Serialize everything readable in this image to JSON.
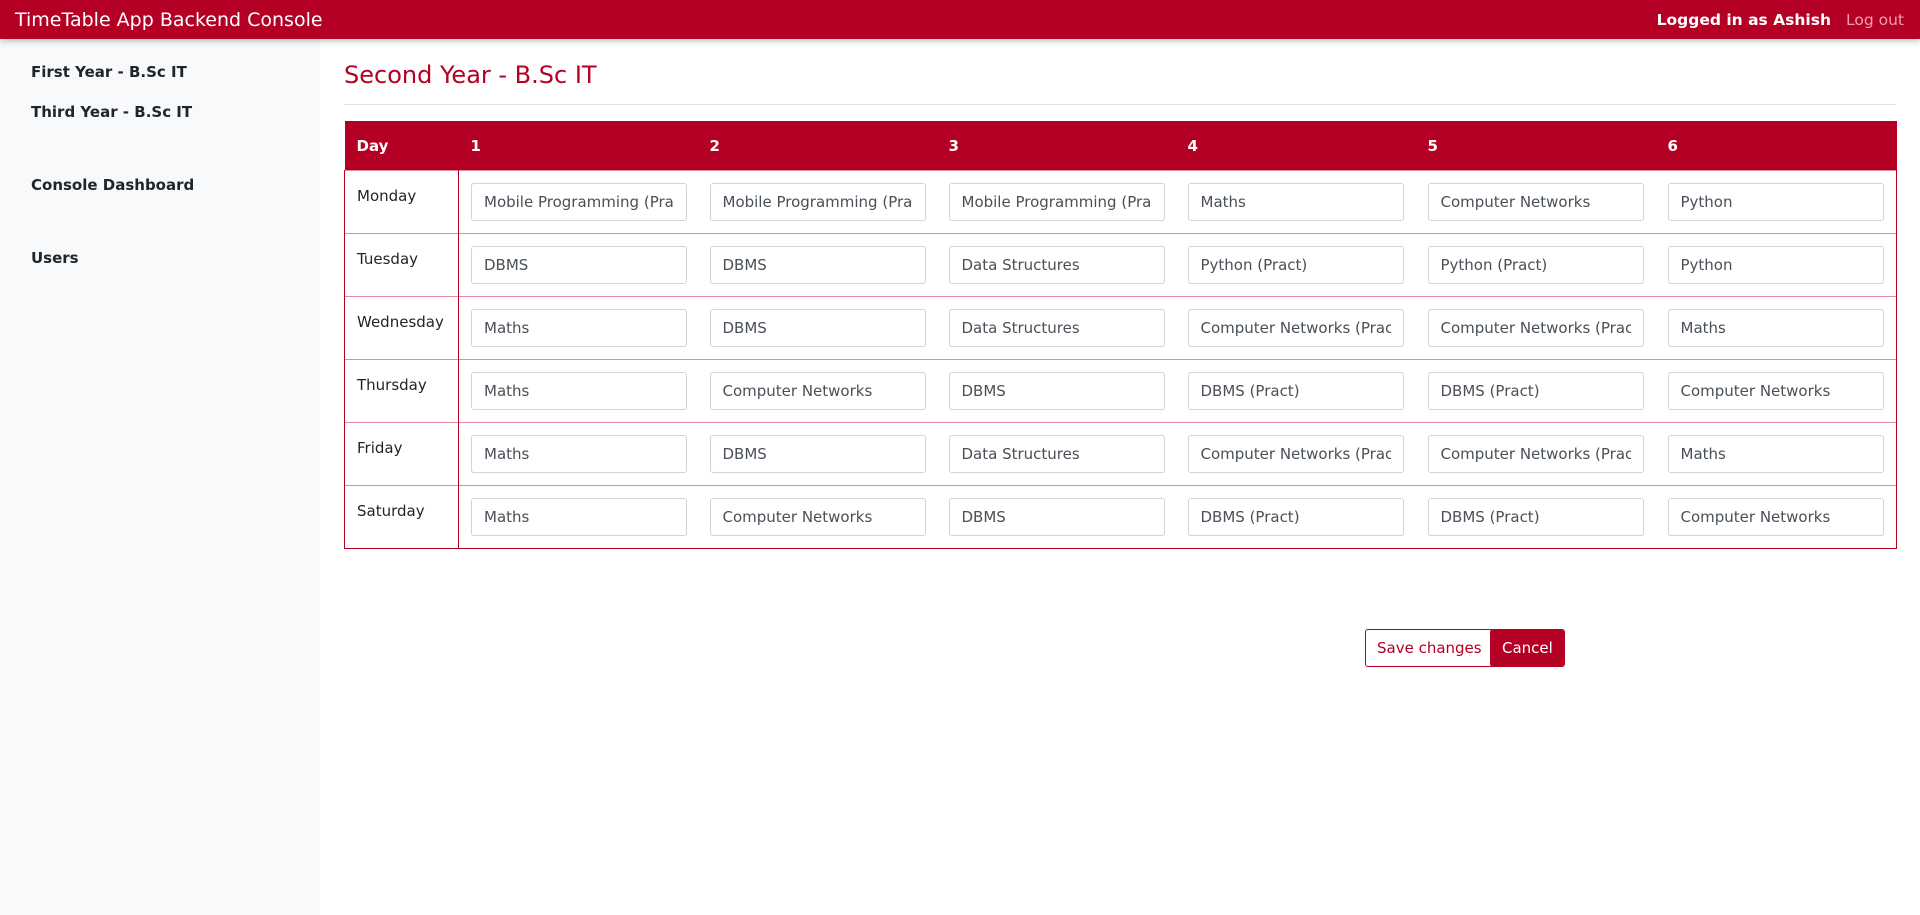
{
  "navbar": {
    "brand": "TimeTable App Backend Console",
    "logged_in": "Logged in as Ashish",
    "logout": "Log out"
  },
  "sidebar": {
    "items": [
      {
        "label": "First Year - B.Sc IT"
      },
      {
        "label": "Third Year - B.Sc IT"
      },
      {
        "label": "Console Dashboard"
      },
      {
        "label": "Users"
      }
    ]
  },
  "main": {
    "title": "Second Year - B.Sc IT",
    "table": {
      "headers": [
        "Day",
        "1",
        "2",
        "3",
        "4",
        "5",
        "6"
      ],
      "rows": [
        {
          "day": "Monday",
          "cells": [
            "Mobile Programming (Pract)",
            "Mobile Programming (Pract)",
            "Mobile Programming (Pract)",
            "Maths",
            "Computer Networks",
            "Python"
          ]
        },
        {
          "day": "Tuesday",
          "cells": [
            "DBMS",
            "DBMS",
            "Data Structures",
            "Python (Pract)",
            "Python (Pract)",
            "Python"
          ]
        },
        {
          "day": "Wednesday",
          "cells": [
            "Maths",
            "DBMS",
            "Data Structures",
            "Computer Networks (Pract)",
            "Computer Networks (Pract)",
            "Maths"
          ]
        },
        {
          "day": "Thursday",
          "cells": [
            "Maths",
            "Computer Networks",
            "DBMS",
            "DBMS (Pract)",
            "DBMS (Pract)",
            "Computer Networks"
          ]
        },
        {
          "day": "Friday",
          "cells": [
            "Maths",
            "DBMS",
            "Data Structures",
            "Computer Networks (Pract)",
            "Computer Networks (Pract)",
            "Maths"
          ]
        },
        {
          "day": "Saturday",
          "cells": [
            "Maths",
            "Computer Networks",
            "DBMS",
            "DBMS (Pract)",
            "DBMS (Pract)",
            "Computer Networks"
          ]
        }
      ]
    },
    "save_label": "Save changes",
    "cancel_label": "Cancel"
  },
  "colors": {
    "brand": "#b40024",
    "sidebar_bg": "#f8f9fa",
    "row_border": "#e58a98"
  }
}
